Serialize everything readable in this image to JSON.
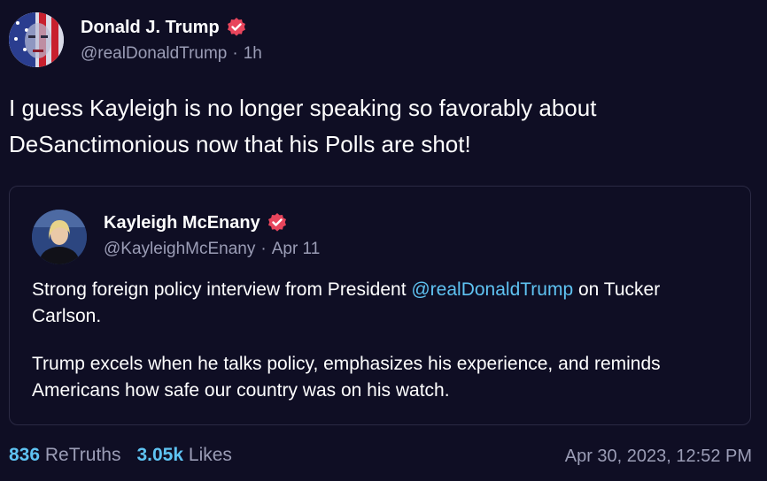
{
  "post": {
    "author_name": "Donald J. Trump",
    "handle": "@realDonaldTrump",
    "time_ago": "1h",
    "meta_separator": "·",
    "text_line1": "I guess Kayleigh is no longer speaking so favorably about",
    "text_line2": "DeSanctimonious now that his Polls are shot!",
    "verified": true
  },
  "quote": {
    "author_name": "Kayleigh McEnany",
    "handle": "@KayleighMcEnany",
    "date": "Apr 11",
    "meta_separator": "·",
    "verified": true,
    "para1_before": "Strong foreign policy interview from President ",
    "para1_mention": "@realDonaldTrump",
    "para1_after": " on Tucker Carlson.",
    "para2": "Trump excels when he talks policy, emphasizes his experience, and reminds Americans how safe our country was on his watch."
  },
  "stats": {
    "retruths_count": "836",
    "retruths_label": "ReTruths",
    "likes_count": "3.05k",
    "likes_label": "Likes",
    "timestamp": "Apr 30, 2023, 12:52 PM"
  },
  "colors": {
    "background": "#0f0e24",
    "accent_link": "#5fc3f2",
    "muted": "#9b9db6",
    "verified_badge": "#e8455c"
  }
}
